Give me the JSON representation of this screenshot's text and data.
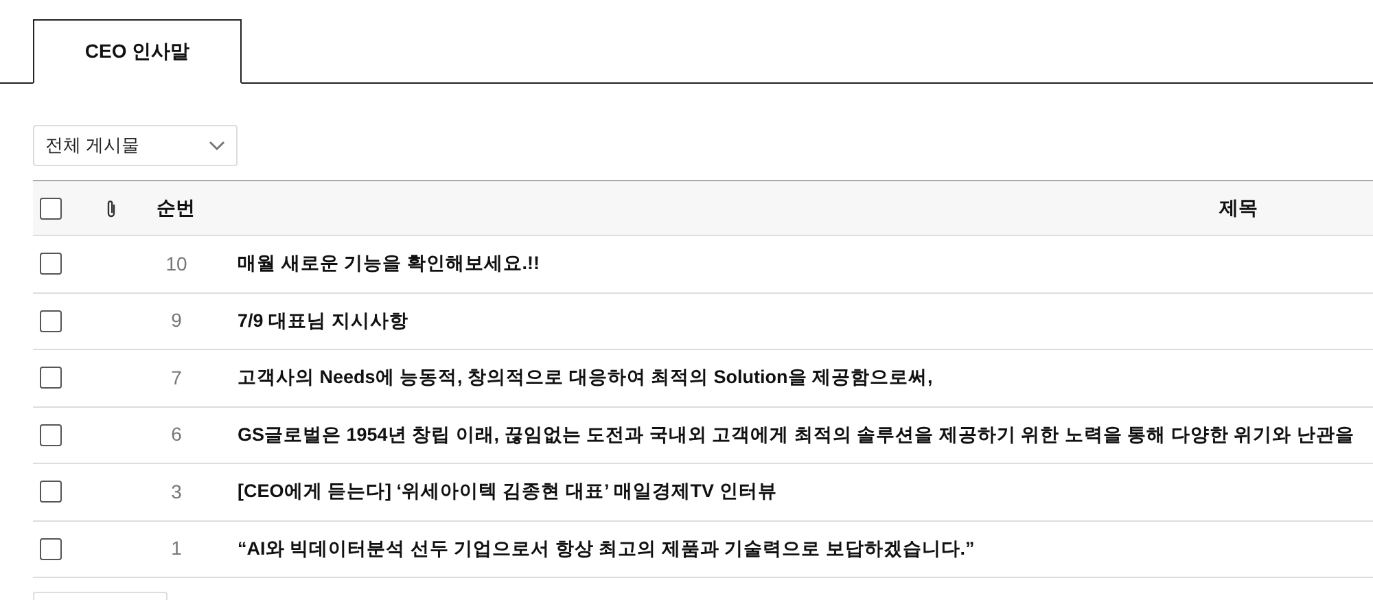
{
  "tabs": [
    {
      "label": "CEO 인사말",
      "selected": true
    }
  ],
  "filter": {
    "value": "전체 게시물"
  },
  "table": {
    "select_all": {
      "checked": false
    },
    "columns": [
      "순번",
      "제목"
    ],
    "rows": [
      {
        "checked": false,
        "number": "10",
        "title": "매월 새로운 기능을 확인해보세요.!!"
      },
      {
        "checked": false,
        "number": "9",
        "title": "7/9 대표님 지시사항"
      },
      {
        "checked": false,
        "number": "7",
        "title": "고객사의 Needs에 능동적, 창의적으로 대응하여 최적의 Solution을 제공함으로써,"
      },
      {
        "checked": false,
        "number": "6",
        "title": "GS글로벌은 1954년 창립 이래, 끊임없는 도전과 국내외 고객에게 최적의 솔루션을 제공하기 위한 노력을 통해 다양한 위기와 난관을"
      },
      {
        "checked": false,
        "number": "3",
        "title": "[CEO에게 듣는다] ‘위세아이텍 김종현 대표’ 매일경제TV 인터뷰"
      },
      {
        "checked": false,
        "number": "1",
        "title": "“AI와 빅데이터분석 선두 기업으로서 항상 최고의 제품과 기술력으로 보답하겠습니다.”"
      }
    ]
  }
}
